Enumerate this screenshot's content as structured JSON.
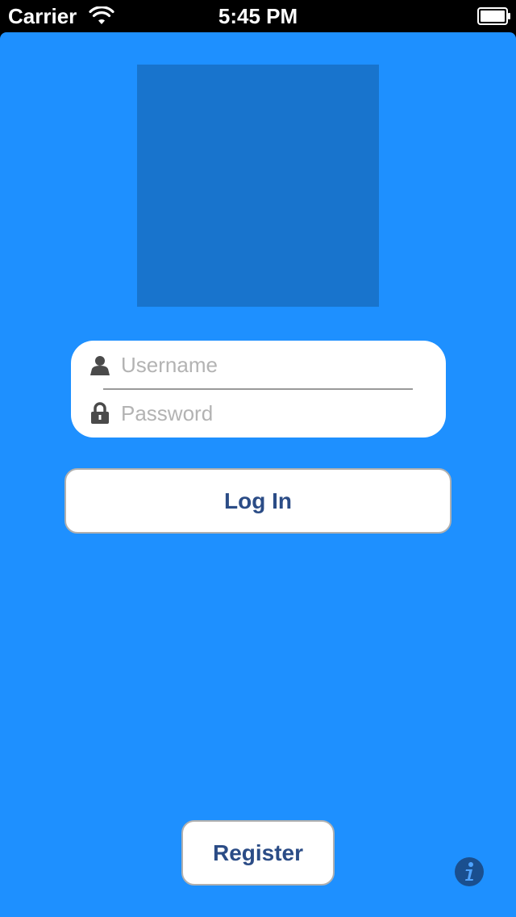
{
  "status_bar": {
    "carrier": "Carrier",
    "time": "5:45 PM"
  },
  "login_form": {
    "username_placeholder": "Username",
    "password_placeholder": "Password"
  },
  "buttons": {
    "login_label": "Log In",
    "register_label": "Register"
  },
  "icons": {
    "user": "user-icon",
    "lock": "lock-icon",
    "info": "info-icon",
    "wifi": "wifi-icon",
    "battery": "battery-icon"
  },
  "colors": {
    "background": "#1e90ff",
    "logo_placeholder": "#1874cd",
    "button_text": "#2b4c86",
    "placeholder_text": "#b3b3b3"
  }
}
